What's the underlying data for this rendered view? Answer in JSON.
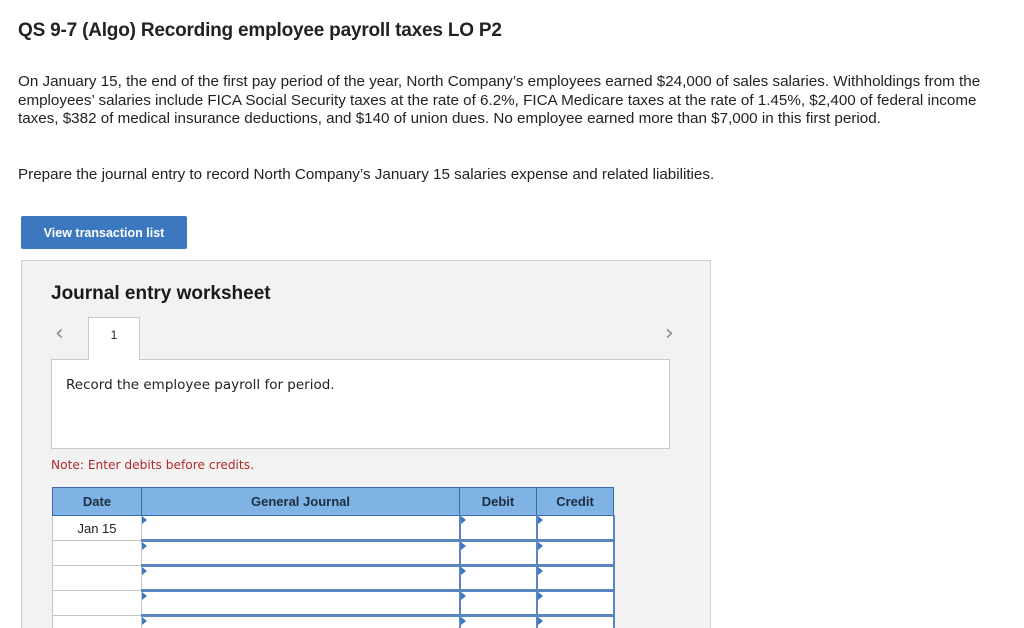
{
  "header": {
    "title": "QS 9-7 (Algo) Recording employee payroll taxes LO P2"
  },
  "problem": {
    "text": "On January 15, the end of the first pay period of the year, North Company’s employees earned $24,000 of sales salaries. Withholdings from the employees’ salaries include FICA Social Security taxes at the rate of 6.2%, FICA Medicare taxes at the rate of 1.45%, $2,400 of federal income taxes, $382 of medical insurance deductions, and $140 of union dues. No employee earned more than $7,000 in this first period.",
    "prompt": "Prepare the journal entry to record North Company’s January 15 salaries expense and related liabilities."
  },
  "buttons": {
    "view_transactions": "View transaction list"
  },
  "worksheet": {
    "heading": "Journal entry worksheet",
    "prev_icon": "‹",
    "next_icon": "›",
    "active_tab": "1",
    "instruction": "Record the employee payroll for period.",
    "note": "Note: Enter debits before credits."
  },
  "journal": {
    "headers": [
      "Date",
      "General Journal",
      "Debit",
      "Credit"
    ],
    "rows": [
      {
        "date": "Jan 15",
        "account": "",
        "debit": "",
        "credit": ""
      },
      {
        "date": "",
        "account": "",
        "debit": "",
        "credit": ""
      },
      {
        "date": "",
        "account": "",
        "debit": "",
        "credit": ""
      },
      {
        "date": "",
        "account": "",
        "debit": "",
        "credit": ""
      },
      {
        "date": "",
        "account": "",
        "debit": "",
        "credit": ""
      }
    ]
  },
  "colors": {
    "button_blue": "#3c78c0",
    "table_header": "#7fb2e5",
    "note_red": "#b02a2a",
    "worksheet_bg": "#f2f2f2"
  }
}
